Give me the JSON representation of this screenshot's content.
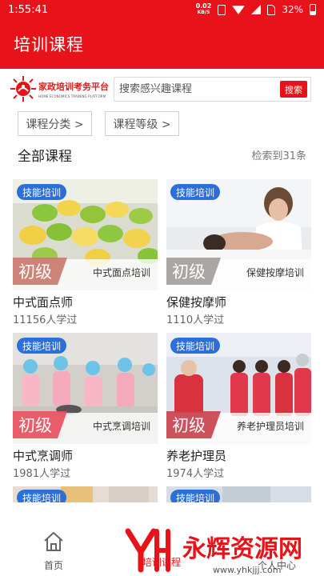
{
  "status_bar": {
    "time": "1:55:41",
    "net_speed_value": "0.02",
    "net_speed_unit": "KB/S",
    "battery": "32%"
  },
  "header": {
    "title": "培训课程"
  },
  "logo": {
    "name_cn": "家政培训考务平台",
    "name_en": "HOME ECONOMICS TRAINING PLATFORM"
  },
  "search": {
    "placeholder": "搜索感兴趣课程",
    "value": "",
    "button_label": "搜索"
  },
  "filters": {
    "category_label": "课程分类 >",
    "level_label": "课程等级 >"
  },
  "section": {
    "title": "全部课程",
    "result_count": "检索到31条"
  },
  "courses": [
    {
      "badge": "技能培训",
      "level": "初级",
      "caption": "中式面点培训",
      "title": "中式面点师",
      "learners": "11156人学过"
    },
    {
      "badge": "技能培训",
      "level": "初级",
      "caption": "保健按摩培训",
      "title": "保健按摩师",
      "learners": "1110人学过"
    },
    {
      "badge": "技能培训",
      "level": "初级",
      "caption": "中式烹调培训",
      "title": "中式烹调师",
      "learners": "1981人学过"
    },
    {
      "badge": "技能培训",
      "level": "初级",
      "caption": "养老护理员培训",
      "title": "养老护理员",
      "learners": "1974人学过"
    },
    {
      "badge": "技能培训"
    },
    {
      "badge": "技能培训"
    }
  ],
  "bottom_nav": {
    "home_label": "首页",
    "training_label": "培训课程",
    "profile_label": "个人中心"
  },
  "watermark": {
    "text": "永辉资源网",
    "url": "www.yhkjjj.com"
  },
  "colors": {
    "primary_red": "#e8131a",
    "badge_blue": "#2b6fd8"
  },
  "icons": [
    "vibrate-icon",
    "wifi-icon",
    "signal-icon",
    "no-sim-icon",
    "battery-icon",
    "home-icon",
    "logo-sun-icon"
  ]
}
